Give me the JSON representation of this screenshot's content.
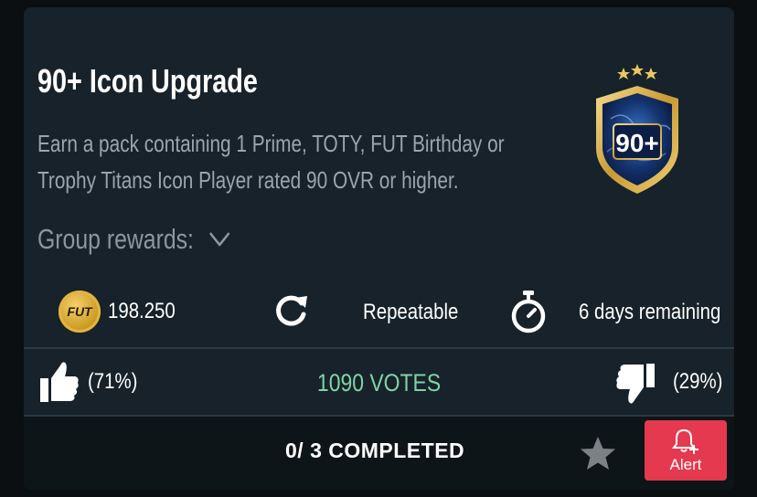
{
  "objective": {
    "title": "90+ Icon Upgrade",
    "description_line1": "Earn a pack containing 1 Prime, TOTY, FUT Birthday or",
    "description_line2": "Trophy Titans Icon Player rated 90 OVR or higher.",
    "group_rewards_label": "Group rewards:",
    "badge_text": "90+"
  },
  "stats": {
    "coin_icon_text": "FUT",
    "coins": "198.250",
    "repeat_label": "Repeatable",
    "time_label": "6 days remaining"
  },
  "votes": {
    "up_percent": "(71%)",
    "count": "1090 VOTES",
    "down_percent": "(29%)"
  },
  "footer": {
    "completed": "0/ 3 COMPLETED",
    "alert_label": "Alert"
  },
  "colors": {
    "card_bg": "#17222a",
    "votes_green": "#7fd3a5",
    "alert_red": "#e4394f",
    "coin_gold": "#e3b440"
  }
}
